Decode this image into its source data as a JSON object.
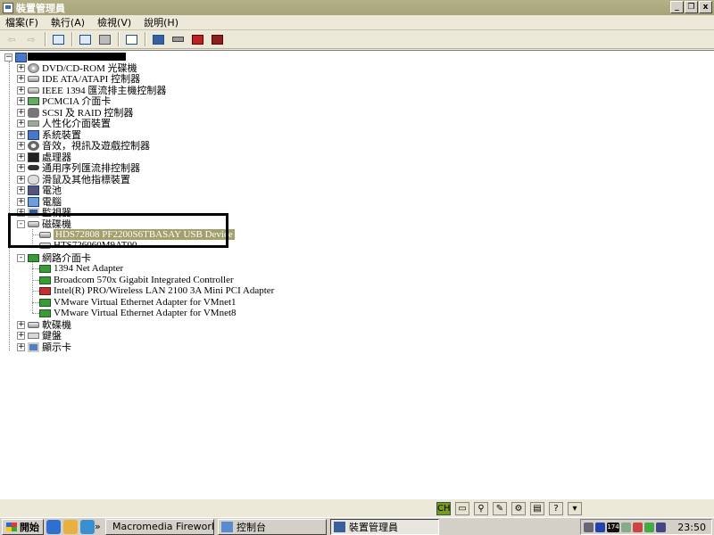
{
  "window": {
    "title": "裝置管理員"
  },
  "window_buttons": {
    "minimize": "_",
    "restore": "❐",
    "close": "x"
  },
  "menu": [
    "檔案(F)",
    "執行(A)",
    "檢視(V)",
    "說明(H)"
  ],
  "toolbar": {
    "icons": [
      "back-arrow-icon",
      "forward-arrow-icon",
      "show-hide-tree-icon",
      "properties-icon",
      "print-icon",
      "help-icon",
      "scan-hardware-icon",
      "update-driver-icon",
      "uninstall-icon"
    ]
  },
  "tree": {
    "root_label_redacted": true,
    "categories": [
      {
        "label": "DVD/CD-ROM 光碟機",
        "expander": "+"
      },
      {
        "label": "IDE ATA/ATAPI 控制器",
        "expander": "+"
      },
      {
        "label": "IEEE 1394 匯流排主機控制器",
        "expander": "+"
      },
      {
        "label": "PCMCIA 介面卡",
        "expander": "+"
      },
      {
        "label": "SCSI 及 RAID 控制器",
        "expander": "+"
      },
      {
        "label": "人性化介面裝置",
        "expander": "+"
      },
      {
        "label": "系統裝置",
        "expander": "+"
      },
      {
        "label": "音效，視訊及遊戲控制器",
        "expander": "+"
      },
      {
        "label": "處理器",
        "expander": "+"
      },
      {
        "label": "通用序列匯流排控制器",
        "expander": "+"
      },
      {
        "label": "滑鼠及其他指標裝置",
        "expander": "+"
      },
      {
        "label": "電池",
        "expander": "+"
      },
      {
        "label": "電腦",
        "expander": "+"
      },
      {
        "label": "監視器",
        "expander": "+"
      }
    ],
    "disk_drives": {
      "label": "磁碟機",
      "expander": "-",
      "children": [
        "HDS72808   PF2200S6TBASAY USB Device",
        "HTS726060M9AT00"
      ]
    },
    "network": {
      "label": "網路介面卡",
      "expander": "-",
      "children": [
        "1394 Net Adapter",
        "Broadcom 570x Gigabit Integrated Controller",
        "Intel(R) PRO/Wireless LAN 2100 3A Mini PCI Adapter",
        "VMware Virtual Ethernet Adapter for VMnet1",
        "VMware Virtual Ethernet Adapter for VMnet8"
      ]
    },
    "after": [
      {
        "label": "軟碟機",
        "expander": "+"
      },
      {
        "label": "鍵盤",
        "expander": "+"
      },
      {
        "label": "顯示卡",
        "expander": "+"
      }
    ]
  },
  "status_bar": {
    "ime_label": "CH",
    "help_label": "?"
  },
  "taskbar": {
    "start": "開始",
    "tasks": [
      "Macromedia Fireworks M...",
      "控制台",
      "裝置管理員"
    ],
    "tray_badge": "174",
    "clock": "23:50"
  },
  "colors": {
    "title_bg": "#a8a37a",
    "selection": "#a3a06c",
    "face": "#ece9d8"
  }
}
